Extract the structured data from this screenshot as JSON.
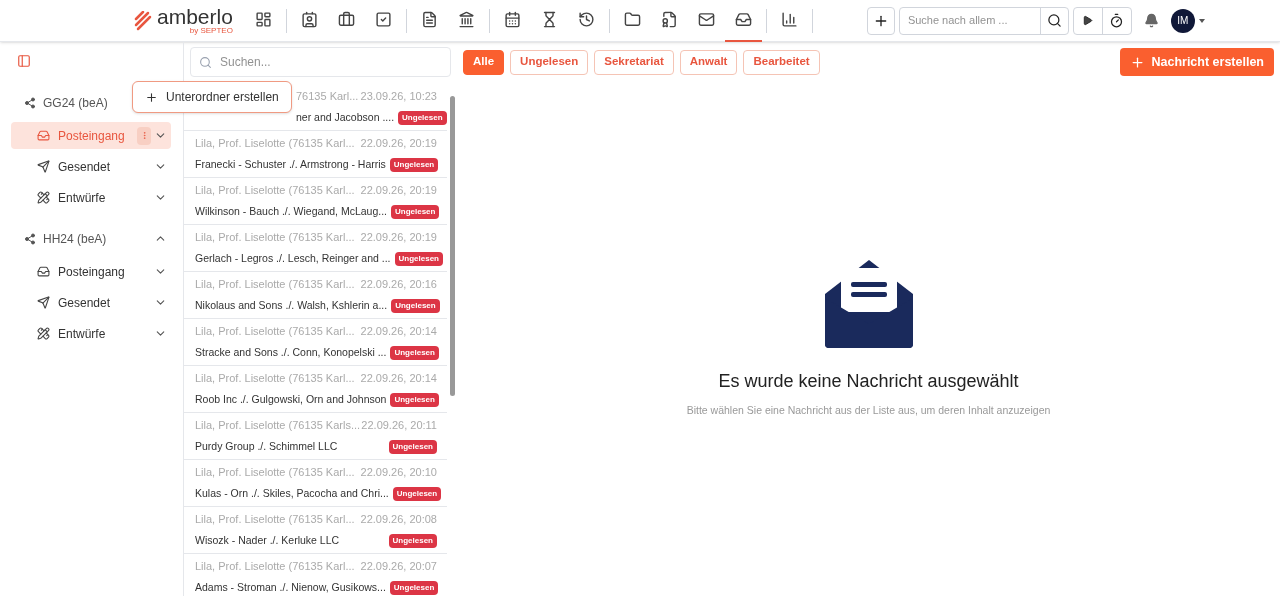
{
  "brand": {
    "name": "amberlo",
    "tagline": "by SEPTEO"
  },
  "nav_icons": [
    {
      "kind": "dashboard",
      "selected": false
    },
    {
      "kind": "contacts",
      "selected": false
    },
    {
      "kind": "cases",
      "selected": false
    },
    {
      "kind": "tasks",
      "selected": false
    },
    {
      "kind": "invoice",
      "selected": false
    },
    {
      "kind": "bank",
      "selected": false
    },
    {
      "kind": "calendar",
      "selected": false
    },
    {
      "kind": "hourglass",
      "selected": false
    },
    {
      "kind": "time-money",
      "selected": false
    },
    {
      "kind": "folder",
      "selected": false
    },
    {
      "kind": "certificate",
      "selected": false
    },
    {
      "kind": "mail",
      "selected": false
    },
    {
      "kind": "inbox",
      "selected": true
    },
    {
      "kind": "reports",
      "selected": false
    }
  ],
  "global_search": {
    "placeholder": "Suche nach allem ..."
  },
  "user": {
    "initials": "IM"
  },
  "sidebar": {
    "accounts": [
      {
        "name": "GG24 (beA)",
        "expanded": true,
        "show_toggle": false,
        "children": [
          {
            "name": "Posteingang",
            "kind": "inbox",
            "selected": true
          },
          {
            "name": "Gesendet",
            "kind": "sent",
            "selected": false
          },
          {
            "name": "Entwürfe",
            "kind": "drafts",
            "selected": false
          }
        ]
      },
      {
        "name": "HH24 (beA)",
        "expanded": true,
        "show_toggle": true,
        "children": [
          {
            "name": "Posteingang",
            "kind": "inbox",
            "selected": false
          },
          {
            "name": "Gesendet",
            "kind": "sent",
            "selected": false
          },
          {
            "name": "Entwürfe",
            "kind": "drafts",
            "selected": false
          }
        ]
      }
    ]
  },
  "popup_menu": {
    "items": [
      "Unterordner erstellen"
    ]
  },
  "list_search": {
    "placeholder": "Suchen..."
  },
  "filters": [
    {
      "label": "Alle",
      "selected": true
    },
    {
      "label": "Ungelesen",
      "selected": false
    },
    {
      "label": "Sekretariat",
      "selected": false
    },
    {
      "label": "Anwalt",
      "selected": false
    },
    {
      "label": "Bearbeitet",
      "selected": false
    }
  ],
  "create_button": "Nachricht erstellen",
  "messages": [
    {
      "sender": "76135 Karl...",
      "date": "23.09.26, 10:23",
      "subject": "ner and Jacobson ....",
      "badge": "Ungelesen",
      "covered": true
    },
    {
      "sender": "Lila, Prof. Liselotte (76135 Karl...",
      "date": "22.09.26, 20:19",
      "subject": "Franecki - Schuster ./. Armstrong - Harris",
      "badge": "Ungelesen",
      "covered": false
    },
    {
      "sender": "Lila, Prof. Liselotte (76135 Karl...",
      "date": "22.09.26, 20:19",
      "subject": "Wilkinson - Bauch ./. Wiegand, McLaug...",
      "badge": "Ungelesen",
      "covered": false
    },
    {
      "sender": "Lila, Prof. Liselotte (76135 Karl...",
      "date": "22.09.26, 20:19",
      "subject": "Gerlach - Legros ./. Lesch, Reinger and ...",
      "badge": "Ungelesen",
      "covered": false
    },
    {
      "sender": "Lila, Prof. Liselotte (76135 Karl...",
      "date": "22.09.26, 20:16",
      "subject": "Nikolaus and Sons ./. Walsh, Kshlerin a...",
      "badge": "Ungelesen",
      "covered": false
    },
    {
      "sender": "Lila, Prof. Liselotte (76135 Karl...",
      "date": "22.09.26, 20:14",
      "subject": "Stracke and Sons ./. Conn, Konopelski ...",
      "badge": "Ungelesen",
      "covered": false
    },
    {
      "sender": "Lila, Prof. Liselotte (76135 Karl...",
      "date": "22.09.26, 20:14",
      "subject": "Roob Inc ./. Gulgowski, Orn and Johnson",
      "badge": "Ungelesen",
      "covered": false
    },
    {
      "sender": "Lila, Prof. Liselotte (76135 Karls...",
      "date": "22.09.26, 20:11",
      "subject": "Purdy Group ./. Schimmel LLC",
      "badge": "Ungelesen",
      "covered": false
    },
    {
      "sender": "Lila, Prof. Liselotte (76135 Karl...",
      "date": "22.09.26, 20:10",
      "subject": "Kulas - Orn ./. Skiles, Pacocha and Chri...",
      "badge": "Ungelesen",
      "covered": false
    },
    {
      "sender": "Lila, Prof. Liselotte (76135 Karl...",
      "date": "22.09.26, 20:08",
      "subject": "Wisozk - Nader ./. Kerluke LLC",
      "badge": "Ungelesen",
      "covered": false
    },
    {
      "sender": "Lila, Prof. Liselotte (76135 Karl...",
      "date": "22.09.26, 20:07",
      "subject": "Adams - Stroman ./. Nienow, Gusikows...",
      "badge": "Ungelesen",
      "covered": false
    }
  ],
  "empty_state": {
    "title": "Es wurde keine Nachricht ausgewählt",
    "subtitle": "Bitte wählen Sie eine Nachricht aus der Liste aus, um deren Inhalt anzuzeigen"
  }
}
